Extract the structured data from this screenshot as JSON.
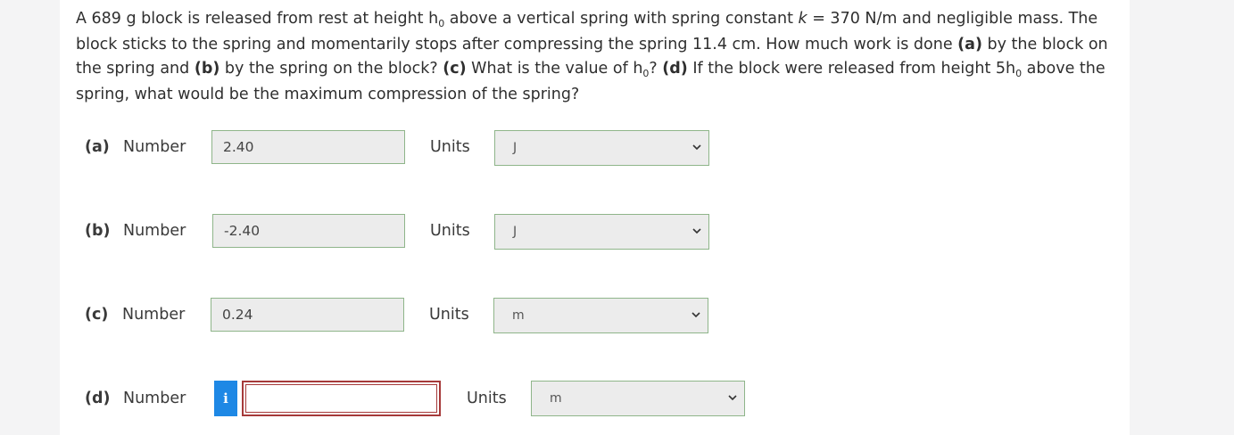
{
  "question": {
    "p1": "A 689 g block is released from rest at height h",
    "sub0": "0",
    "p2": " above a vertical spring with spring constant ",
    "k": "k",
    "p3": " = 370 N/m and negligible mass. The block sticks to the spring and momentarily stops after compressing the spring 11.4 cm. How much work is done ",
    "a_tag": "(a)",
    "p4": " by the block on the spring and ",
    "b_tag": "(b)",
    "p5": " by the spring on the block? ",
    "c_tag": "(c)",
    "p6": " What is the value of h",
    "sub1": "0",
    "p7": "? ",
    "d_tag": "(d)",
    "p8": " If the block were released from height 5h",
    "sub2": "0",
    "p9": " above the spring, what would be the maximum compression of the spring?"
  },
  "parts": [
    {
      "label": "(a)",
      "number_label": "Number",
      "value": "2.40",
      "units_label": "Units",
      "unit": "J"
    },
    {
      "label": "(b)",
      "number_label": "Number",
      "value": "-2.40",
      "units_label": "Units",
      "unit": "J"
    },
    {
      "label": "(c)",
      "number_label": "Number",
      "value": "0.24",
      "units_label": "Units",
      "unit": "m"
    },
    {
      "label": "(d)",
      "number_label": "Number",
      "value": "",
      "units_label": "Units",
      "unit": "m",
      "info_icon": "i"
    }
  ],
  "colors": {
    "field_border": "#8fb58a",
    "error_border": "#a63a3a",
    "info_button": "#1e88e5"
  }
}
